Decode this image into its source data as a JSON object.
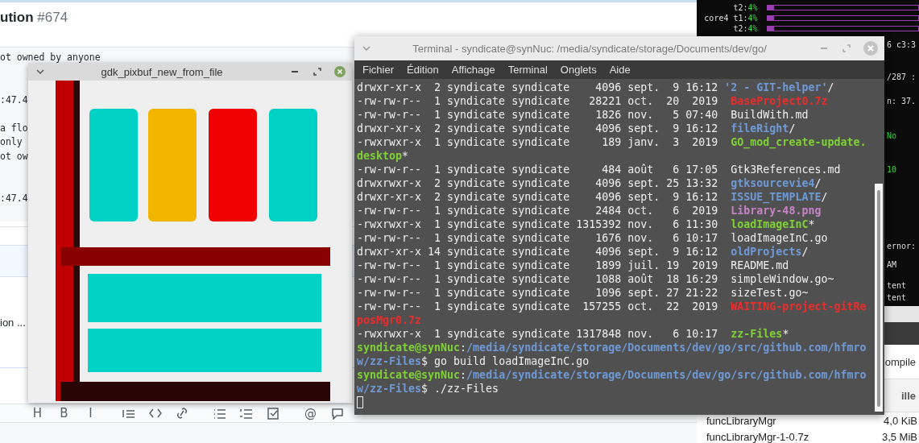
{
  "browser": {
    "title": "ution",
    "number": "#674",
    "code_lines": [
      "ot owned by anyone",
      ":47.4",
      "a flo",
      "only",
      "ot ow",
      ":47.4"
    ],
    "row_text": "ion ...",
    "toolbar": [
      {
        "kind": "glyph",
        "glyph": "H"
      },
      {
        "kind": "glyph",
        "glyph": "B"
      },
      {
        "kind": "glyph",
        "glyph": "I"
      },
      {
        "kind": "quote"
      },
      {
        "kind": "code"
      },
      {
        "kind": "link"
      },
      {
        "kind": "bullets"
      },
      {
        "kind": "numbers"
      },
      {
        "kind": "task"
      },
      {
        "kind": "glyph",
        "glyph": "@"
      },
      {
        "kind": "reply"
      }
    ]
  },
  "conky": {
    "cores": [
      {
        "label": "t2:",
        "value": "4%",
        "level": 0.04
      },
      {
        "label": "core4 t1:",
        "value": "4%",
        "level": 0.04
      },
      {
        "label": "t2:",
        "value": "4%",
        "level": 0.04
      }
    ],
    "fragments": [
      {
        "text": "6 c3:3",
        "kind": "label"
      },
      {
        "text": "/287 :",
        "kind": "label"
      },
      {
        "text": "n: 37.",
        "kind": "label"
      },
      {
        "text": "No",
        "kind": "value"
      },
      {
        "text": "10",
        "kind": "value"
      },
      {
        "text": "ernor:",
        "kind": "label"
      },
      {
        "text": "AM",
        "kind": "label"
      },
      {
        "text": "tent",
        "kind": "label"
      },
      {
        "text": "tent",
        "kind": "label"
      }
    ]
  },
  "file_manager": {
    "path": "ompile",
    "column": "ille",
    "files": [
      {
        "name": "funcLibraryMgr",
        "size": "4,0 KiB"
      },
      {
        "name": "funcLibraryMgr-1-0.7z",
        "size": "3,5 MiB"
      }
    ]
  },
  "image_window": {
    "title": "gdk_pixbuf_new_from_file"
  },
  "terminal": {
    "title": "Terminal - syndicate@synNuc: /media/syndicate/storage/Documents/dev/go/",
    "menu": [
      "Fichier",
      "Édition",
      "Affichage",
      "Terminal",
      "Onglets",
      "Aide"
    ],
    "entries": [
      {
        "info": "drwxr-xr-x  2 syndicate syndicate    4096 sept.  9 16:12 ",
        "name": "'2 - GIT-helper'",
        "suffix": "/",
        "kind": "dir"
      },
      {
        "info": "-rw-rw-r--  1 syndicate syndicate   28221 oct.  20  2019  ",
        "name": "BaseProject0.7z",
        "kind": "archive"
      },
      {
        "info": "-rw-rw-r--  1 syndicate syndicate    1826 nov.   5 07:40  ",
        "name": "BuildWith.md",
        "kind": "file"
      },
      {
        "info": "drwxr-xr-x  2 syndicate syndicate    4096 sept.  9 16:12  ",
        "name": "fileRight",
        "suffix": "/",
        "kind": "dir"
      },
      {
        "info": "-rwxrwxr-x  1 syndicate syndicate     189 janv.  3  2019  ",
        "name": "GO_mod_create-update.desktop",
        "suffix": "*",
        "kind": "exec"
      },
      {
        "info": "-rw-rw-r--  1 syndicate syndicate     484 août   6 17:05  ",
        "name": "Gtk3References.md",
        "kind": "file"
      },
      {
        "info": "drwxrwxr-x  2 syndicate syndicate    4096 sept. 25 13:32  ",
        "name": "gtksourcevie4",
        "suffix": "/",
        "kind": "dir"
      },
      {
        "info": "drwxr-xr-x  2 syndicate syndicate    4096 sept.  9 16:12  ",
        "name": "ISSUE_TEMPLATE",
        "suffix": "/",
        "kind": "dir"
      },
      {
        "info": "-rw-rw-r--  1 syndicate syndicate    2484 oct.   6  2019  ",
        "name": "Library-48.png",
        "kind": "image"
      },
      {
        "info": "-rwxrwxr-x  1 syndicate syndicate 1315392 nov.   6 11:30  ",
        "name": "loadImageInC",
        "suffix": "*",
        "kind": "exec"
      },
      {
        "info": "-rw-rw-r--  1 syndicate syndicate    1676 nov.   6 10:17  ",
        "name": "loadImageInC.go",
        "kind": "file"
      },
      {
        "info": "drwxr-xr-x 14 syndicate syndicate    4096 sept.  9 16:12  ",
        "name": "oldProjects",
        "suffix": "/",
        "kind": "dir"
      },
      {
        "info": "-rw-rw-r--  1 syndicate syndicate    1899 juil. 19  2019  ",
        "name": "README.md",
        "kind": "file"
      },
      {
        "info": "-rw-rw-r--  1 syndicate syndicate    1088 août  18 16:29  ",
        "name": "simpleWindow.go~",
        "kind": "file"
      },
      {
        "info": "-rw-rw-r--  1 syndicate syndicate    1096 sept. 27 21:22  ",
        "name": "sizeTest.go~",
        "kind": "file"
      },
      {
        "info": "-rw-rw-r--  1 syndicate syndicate  157255 oct.  22  2019  ",
        "name": "WAITING-project-gitReposMgr0.7z",
        "kind": "archive"
      },
      {
        "info": "-rwxrwxr-x  1 syndicate syndicate 1317848 nov.   6 10:17  ",
        "name": "zz-Files",
        "suffix": "*",
        "kind": "exec"
      }
    ],
    "prompts": [
      {
        "user": "syndicate@synNuc",
        "sep": ":",
        "path": "/media/syndicate/storage/Documents/dev/go/src/github.com/hfmrow/zz-Files",
        "command": "$ go build loadImageInC.go"
      },
      {
        "user": "syndicate@synNuc",
        "sep": ":",
        "path": "/media/syndicate/storage/Documents/dev/go/src/github.com/hfmrow/zz-Files",
        "command": "$ ./zz-Files"
      }
    ]
  }
}
